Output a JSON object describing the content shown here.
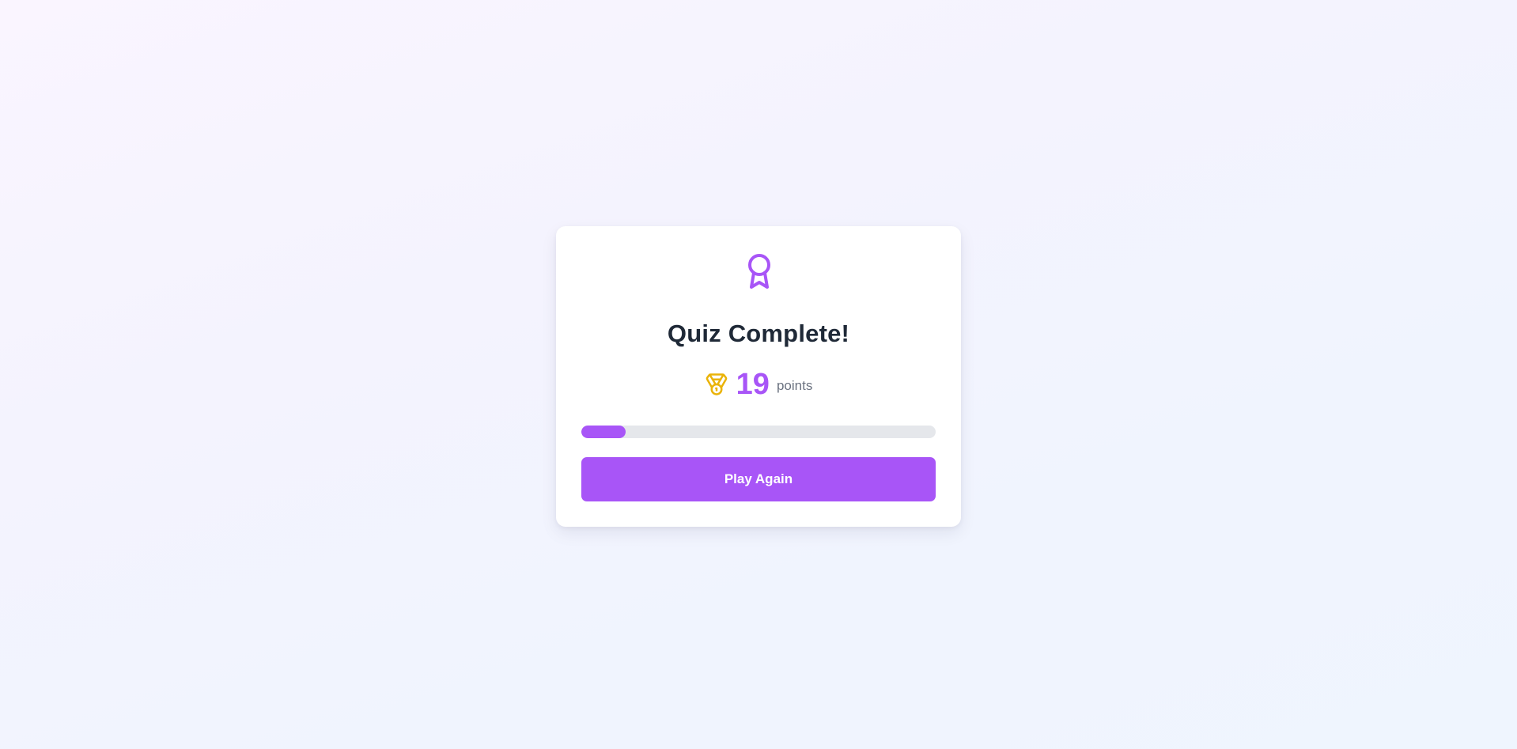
{
  "result": {
    "icon": "award-ribbon-icon",
    "title": "Quiz Complete!",
    "score": {
      "icon": "medal-icon",
      "value": "19",
      "unit": "points"
    },
    "progress_fraction": 0.126,
    "play_again_label": "Play Again"
  },
  "colors": {
    "accent": "#a855f7",
    "medal": "#eab308",
    "title": "#1f2937",
    "muted": "#6b7280",
    "track": "#e5e7eb"
  }
}
